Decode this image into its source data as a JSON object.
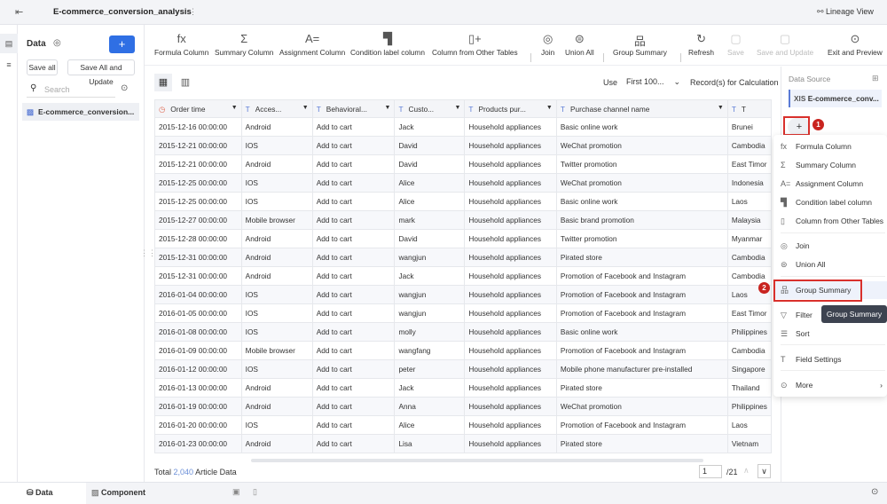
{
  "header": {
    "title": "E-commerce_conversion_analysis",
    "more": "⋮",
    "lineage": "Lineage View"
  },
  "datapanel": {
    "title": "Data",
    "add": "+",
    "save_all": "Save all",
    "save_all_update": "Save All and Update",
    "search_placeholder": "Search",
    "item": "E-commerce_conversion..."
  },
  "toolbar": [
    {
      "label": "Formula Column",
      "icon": "fx"
    },
    {
      "label": "Summary Column",
      "icon": "Σ"
    },
    {
      "label": "Assignment Column",
      "icon": "A="
    },
    {
      "label": "Condition label column",
      "icon": "▜"
    },
    {
      "label": "Column from Other Tables",
      "icon": "▯+"
    },
    {
      "label": "Join",
      "icon": "◎"
    },
    {
      "label": "Union All",
      "icon": "⊜"
    },
    {
      "label": "Group Summary",
      "icon": "品"
    },
    {
      "label": "Refresh",
      "icon": "↻"
    },
    {
      "label": "Save",
      "icon": "▢"
    },
    {
      "label": "Save and Update",
      "icon": "▢"
    },
    {
      "label": "Exit and Preview",
      "icon": "⊙"
    }
  ],
  "table_controls": {
    "use": "Use",
    "sample": "First 100...",
    "records_label": "Record(s) for Calculation"
  },
  "columns": [
    "Order time",
    "Acces...",
    "Behavioral...",
    "Custo...",
    "Products pur...",
    "Purchase channel name",
    "T"
  ],
  "rows": [
    [
      "2015-12-16 00:00:00",
      "Android",
      "Add to cart",
      "Jack",
      "Household appliances",
      "Basic online work",
      "Brunei"
    ],
    [
      "2015-12-21 00:00:00",
      "IOS",
      "Add to cart",
      "David",
      "Household appliances",
      "WeChat promotion",
      "Cambodia"
    ],
    [
      "2015-12-21 00:00:00",
      "Android",
      "Add to cart",
      "David",
      "Household appliances",
      "Twitter promotion",
      "East Timor"
    ],
    [
      "2015-12-25 00:00:00",
      "IOS",
      "Add to cart",
      "Alice",
      "Household appliances",
      "WeChat promotion",
      "Indonesia"
    ],
    [
      "2015-12-25 00:00:00",
      "IOS",
      "Add to cart",
      "Alice",
      "Household appliances",
      "Basic online work",
      "Laos"
    ],
    [
      "2015-12-27 00:00:00",
      "Mobile browser",
      "Add to cart",
      "mark",
      "Household appliances",
      "Basic brand promotion",
      "Malaysia"
    ],
    [
      "2015-12-28 00:00:00",
      "Android",
      "Add to cart",
      "David",
      "Household appliances",
      "Twitter promotion",
      "Myanmar"
    ],
    [
      "2015-12-31 00:00:00",
      "Android",
      "Add to cart",
      "wangjun",
      "Household appliances",
      "Pirated store",
      "Cambodia"
    ],
    [
      "2015-12-31 00:00:00",
      "Android",
      "Add to cart",
      "Jack",
      "Household appliances",
      "Promotion of Facebook and Instagram",
      "Cambodia"
    ],
    [
      "2016-01-04 00:00:00",
      "IOS",
      "Add to cart",
      "wangjun",
      "Household appliances",
      "Promotion of Facebook and Instagram",
      "Laos"
    ],
    [
      "2016-01-05 00:00:00",
      "IOS",
      "Add to cart",
      "wangjun",
      "Household appliances",
      "Promotion of Facebook and Instagram",
      "East Timor"
    ],
    [
      "2016-01-08 00:00:00",
      "IOS",
      "Add to cart",
      "molly",
      "Household appliances",
      "Basic online work",
      "Philippines"
    ],
    [
      "2016-01-09 00:00:00",
      "Mobile browser",
      "Add to cart",
      "wangfang",
      "Household appliances",
      "Promotion of Facebook and Instagram",
      "Cambodia"
    ],
    [
      "2016-01-12 00:00:00",
      "IOS",
      "Add to cart",
      "peter",
      "Household appliances",
      "Mobile phone manufacturer pre-installed",
      "Singapore"
    ],
    [
      "2016-01-13 00:00:00",
      "Android",
      "Add to cart",
      "Jack",
      "Household appliances",
      "Pirated store",
      "Thailand"
    ],
    [
      "2016-01-19 00:00:00",
      "Android",
      "Add to cart",
      "Anna",
      "Household appliances",
      "WeChat promotion",
      "Philippines"
    ],
    [
      "2016-01-20 00:00:00",
      "IOS",
      "Add to cart",
      "Alice",
      "Household appliances",
      "Promotion of Facebook and Instagram",
      "Laos"
    ],
    [
      "2016-01-23 00:00:00",
      "Android",
      "Add to cart",
      "Lisa",
      "Household appliances",
      "Pirated store",
      "Vietnam"
    ]
  ],
  "footer": {
    "total_prefix": "Total",
    "total": "2,040",
    "total_suffix": "Article Data",
    "page": "1",
    "pages": "/21"
  },
  "rightpanel": {
    "title": "Data Source",
    "source": "E-commerce_conv...",
    "add": "+"
  },
  "menu": [
    {
      "label": "Formula Column",
      "icon": "fx"
    },
    {
      "label": "Summary Column",
      "icon": "Σ"
    },
    {
      "label": "Assignment Column",
      "icon": "A="
    },
    {
      "label": "Condition label column",
      "icon": "▜"
    },
    {
      "label": "Column from Other Tables",
      "icon": "▯"
    },
    {
      "label": "Join",
      "icon": "◎"
    },
    {
      "label": "Union All",
      "icon": "⊜"
    },
    {
      "label": "Group Summary",
      "icon": "品"
    },
    {
      "label": "Filter",
      "icon": "▽"
    },
    {
      "label": "Sort",
      "icon": "☰"
    },
    {
      "label": "Field Settings",
      "icon": "T"
    },
    {
      "label": "More",
      "icon": "⊙"
    }
  ],
  "tooltip": "Group Summary",
  "badges": [
    "1",
    "2"
  ],
  "bottom": {
    "data_tab": "Data",
    "component_tab": "Component"
  },
  "colors": {
    "accent": "#2f6fe4",
    "highlight": "#d9302c"
  }
}
